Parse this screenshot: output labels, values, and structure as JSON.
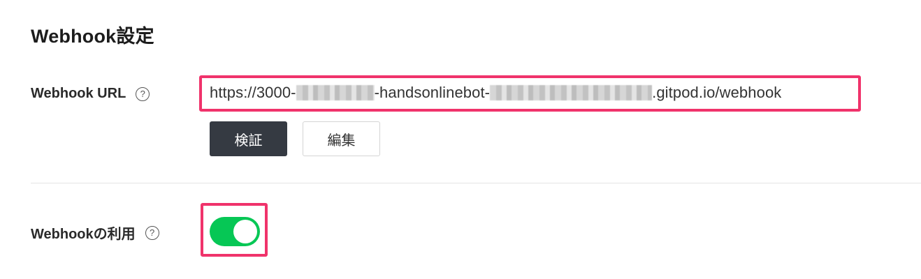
{
  "section": {
    "title": "Webhook設定"
  },
  "webhook_url": {
    "label": "Webhook URL",
    "help": "?",
    "value_prefix": "https://3000-",
    "value_middle": "-handsonlinebot-",
    "value_suffix": ".gitpod.io/webhook"
  },
  "buttons": {
    "verify_label": "検証",
    "edit_label": "編集"
  },
  "use_webhook": {
    "label": "Webhookの利用",
    "help": "?",
    "enabled": true
  },
  "colors": {
    "highlight": "#f0336b",
    "toggle_on": "#06c755",
    "verify_button": "#353a42"
  }
}
